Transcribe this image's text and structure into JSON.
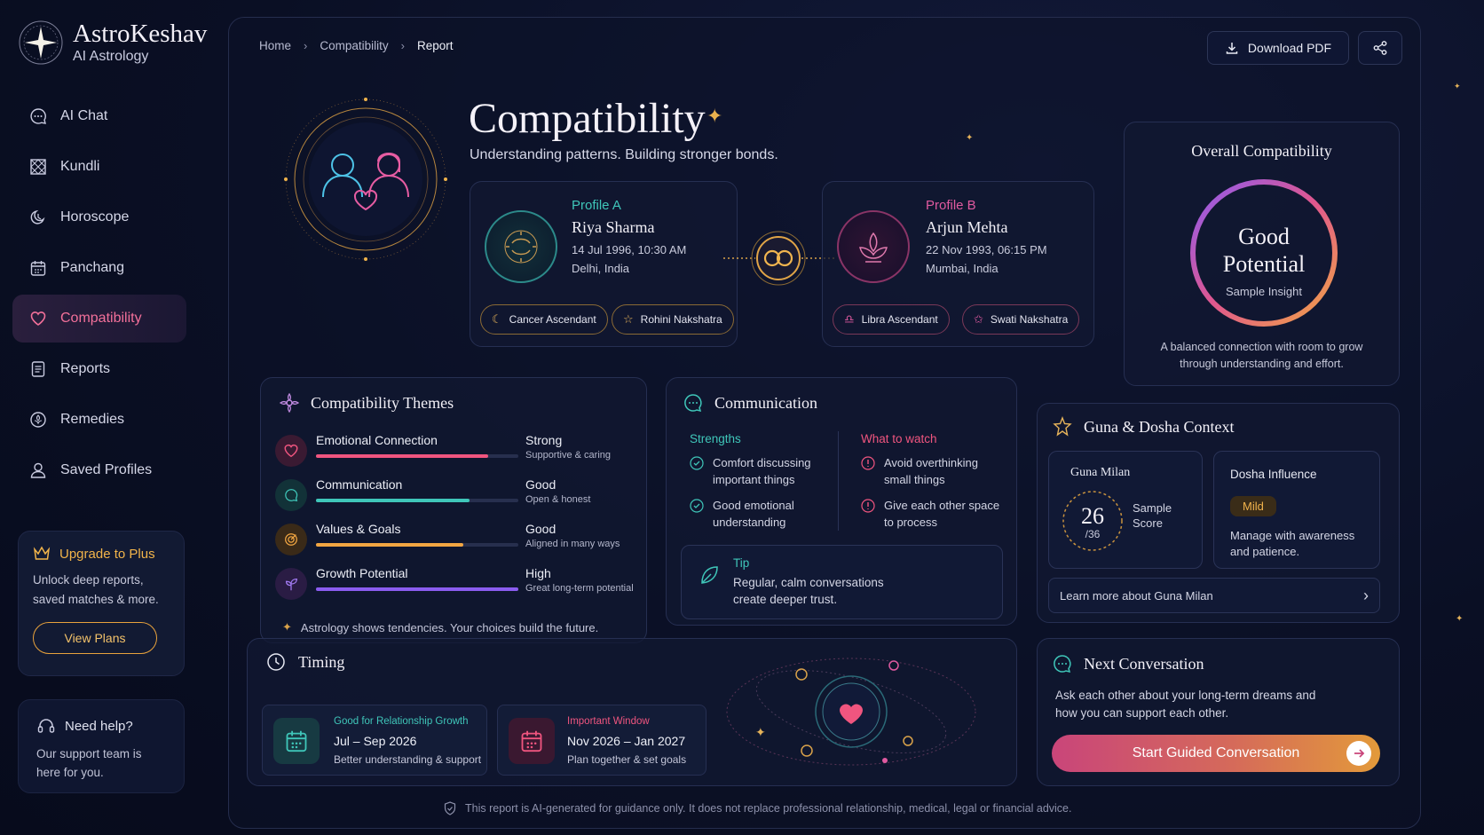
{
  "brand": {
    "name": "AstroKeshav",
    "subtitle": "AI Astrology"
  },
  "nav": [
    {
      "label": "AI Chat",
      "icon": "chat-bubble-icon",
      "active": false
    },
    {
      "label": "Kundli",
      "icon": "chart-grid-icon",
      "active": false
    },
    {
      "label": "Horoscope",
      "icon": "moon-cycle-icon",
      "active": false
    },
    {
      "label": "Panchang",
      "icon": "calendar-icon",
      "active": false
    },
    {
      "label": "Compatibility",
      "icon": "heart-icon",
      "active": true
    },
    {
      "label": "Reports",
      "icon": "document-icon",
      "active": false
    },
    {
      "label": "Remedies",
      "icon": "remedy-icon",
      "active": false
    },
    {
      "label": "Saved Profiles",
      "icon": "user-icon",
      "active": false
    }
  ],
  "upgrade": {
    "title": "Upgrade to Plus",
    "text": "Unlock deep reports, saved matches & more.",
    "button": "View Plans"
  },
  "help": {
    "title": "Need help?",
    "text": "Our support team is here for you."
  },
  "breadcrumb": {
    "home": "Home",
    "section": "Compatibility",
    "current": "Report"
  },
  "actions": {
    "download": "Download PDF"
  },
  "page": {
    "title": "Compatibility",
    "subtitle": "Understanding patterns. Building stronger bonds."
  },
  "profile_a": {
    "label": "Profile A",
    "name": "Riya Sharma",
    "datetime": "14 Jul 1996, 10:30 AM",
    "place": "Delhi, India",
    "ascendant": "Cancer Ascendant",
    "nakshatra": "Rohini Nakshatra"
  },
  "profile_b": {
    "label": "Profile B",
    "name": "Arjun Mehta",
    "datetime": "22 Nov 1993, 06:15 PM",
    "place": "Mumbai, India",
    "ascendant": "Libra Ascendant",
    "nakshatra": "Swati Nakshatra"
  },
  "overall": {
    "title": "Overall Compatibility",
    "verdict_line1": "Good",
    "verdict_line2": "Potential",
    "note": "Sample Insight",
    "description": "A balanced connection with room to grow through understanding and effort."
  },
  "themes": {
    "title": "Compatibility Themes",
    "items": [
      {
        "name": "Emotional Connection",
        "level": "Strong",
        "desc": "Supportive & caring",
        "score": 0.85,
        "color": "#f0557f"
      },
      {
        "name": "Communication",
        "level": "Good",
        "desc": "Open & honest",
        "score": 0.76,
        "color": "#3fc6b9"
      },
      {
        "name": "Values & Goals",
        "level": "Good",
        "desc": "Aligned in many ways",
        "score": 0.73,
        "color": "#f2a642"
      },
      {
        "name": "Growth Potential",
        "level": "High",
        "desc": "Great long-term potential",
        "score": 1.0,
        "color": "#8b5cf0"
      }
    ],
    "footer": "Astrology shows tendencies. Your choices build the future."
  },
  "communication": {
    "title": "Communication",
    "strengths_title": "Strengths",
    "strengths": [
      "Comfort discussing important things",
      "Good emotional understanding"
    ],
    "watch_title": "What to watch",
    "watch": [
      "Avoid overthinking small things",
      "Give each other space to process"
    ],
    "tip_title": "Tip",
    "tip_text": "Regular, calm conversations create deeper trust."
  },
  "guna": {
    "title": "Guna & Dosha Context",
    "milan_title": "Guna Milan",
    "score": "26",
    "total": "/36",
    "score_label_line1": "Sample",
    "score_label_line2": "Score",
    "dosha_title": "Dosha Influence",
    "dosha_badge": "Mild",
    "dosha_text": "Manage with awareness and patience.",
    "link": "Learn more about Guna Milan"
  },
  "timing": {
    "title": "Timing",
    "windows": [
      {
        "tag": "Good for Relationship Growth",
        "range": "Jul – Sep 2026",
        "desc": "Better understanding & support"
      },
      {
        "tag": "Important Window",
        "range": "Nov 2026 – Jan 2027",
        "desc": "Plan together & set goals"
      }
    ]
  },
  "next": {
    "title": "Next Conversation",
    "text": "Ask each other about your long-term dreams and how you can support each other.",
    "button": "Start Guided Conversation"
  },
  "footer": "This report is AI-generated for guidance only. It does not replace professional relationship, medical, legal or financial advice.",
  "colors": {
    "accent_pink": "#f0557f",
    "accent_gold": "#f2b44a",
    "accent_teal": "#3fc6b9",
    "accent_purple": "#8b5cf0"
  }
}
